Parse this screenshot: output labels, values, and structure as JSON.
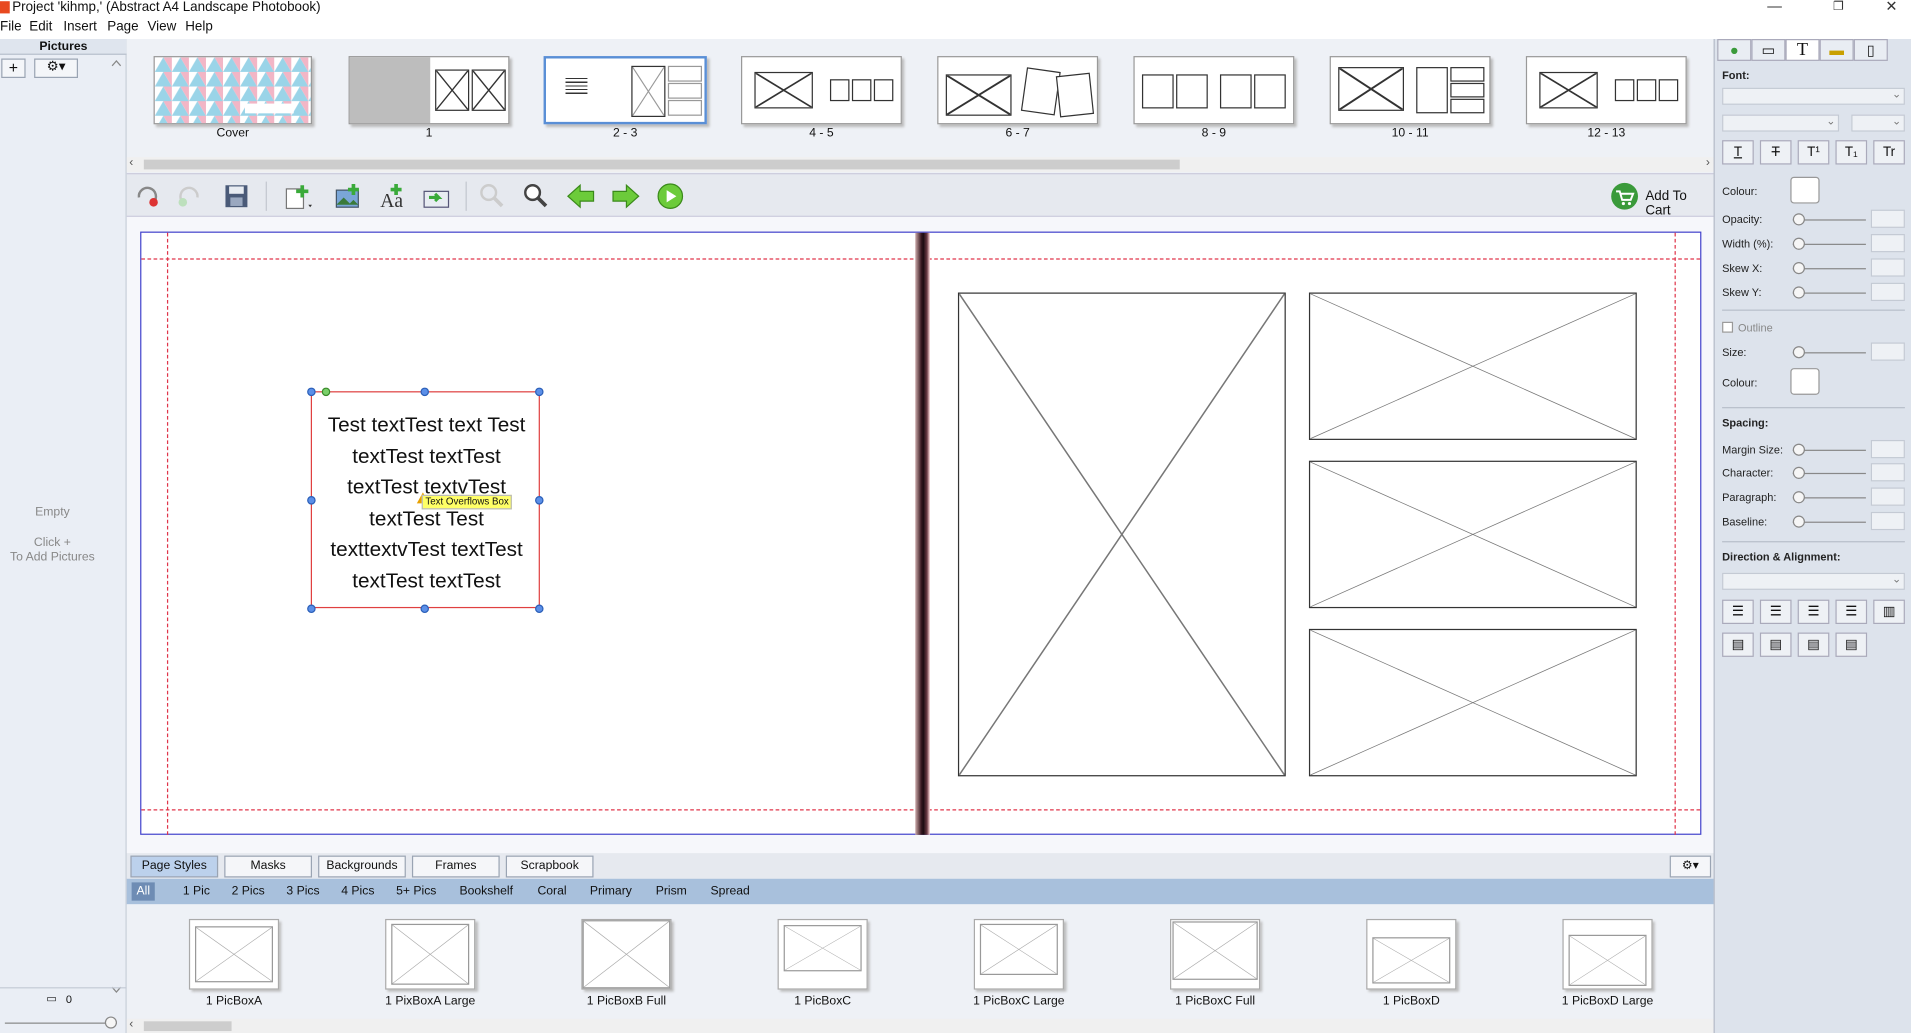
{
  "window": {
    "title": "Project 'kihmp,' (Abstract A4 Landscape Photobook)"
  },
  "menu": [
    "File",
    "Edit",
    "Insert",
    "Page",
    "View",
    "Help"
  ],
  "pictures_panel": {
    "title": "Pictures",
    "add_label": "+",
    "empty_text": "Empty",
    "hint_line1": "Click +",
    "hint_line2": "To Add Pictures",
    "count": "0"
  },
  "thumbnails": [
    {
      "label": "Cover"
    },
    {
      "label": "1"
    },
    {
      "label": "2 - 3",
      "selected": true
    },
    {
      "label": "4 - 5"
    },
    {
      "label": "6 - 7"
    },
    {
      "label": "8 - 9"
    },
    {
      "label": "10 - 11"
    },
    {
      "label": "12 - 13"
    }
  ],
  "toolbar": {
    "add_to_cart": "Add To Cart"
  },
  "canvas": {
    "text_content": "Test textTest text Test textTest textTest textTest textvTest textTest Test texttextvTest textTest textTest textTest",
    "text_lines": [
      "Test textTest text Test",
      "textTest textTest",
      "textTest textvTest",
      "textTest Test",
      "texttextvTest textTest",
      "textTest textTest"
    ],
    "overflow_tooltip": "Text Overflows Box"
  },
  "bottom_tabs": [
    "Page Styles",
    "Masks",
    "Backgrounds",
    "Frames",
    "Scrapbook"
  ],
  "filters": [
    "All",
    "1 Pic",
    "2 Pics",
    "3 Pics",
    "4 Pics",
    "5+ Pics",
    "Bookshelf",
    "Coral",
    "Primary",
    "Prism",
    "Spread"
  ],
  "styles": [
    "1 PicBoxA",
    "1 PixBoxA Large",
    "1 PicBoxB Full",
    "1 PicBoxC",
    "1 PicBoxC Large",
    "1 PicBoxC Full",
    "1 PicBoxD",
    "1 PicBoxD Large"
  ],
  "properties": {
    "font_label": "Font:",
    "colour_label": "Colour:",
    "opacity_label": "Opacity:",
    "width_label": "Width (%):",
    "skewx_label": "Skew X:",
    "skewy_label": "Skew Y:",
    "outline_label": "Outline",
    "size_label": "Size:",
    "outline_colour_label": "Colour:",
    "spacing_label": "Spacing:",
    "margin_label": "Margin Size:",
    "character_label": "Character:",
    "paragraph_label": "Paragraph:",
    "baseline_label": "Baseline:",
    "direction_label": "Direction & Alignment:"
  },
  "colors": {
    "accent": "#5a8fd6",
    "guide": "#e0354a",
    "filter_bar": "#a8c0dc"
  }
}
